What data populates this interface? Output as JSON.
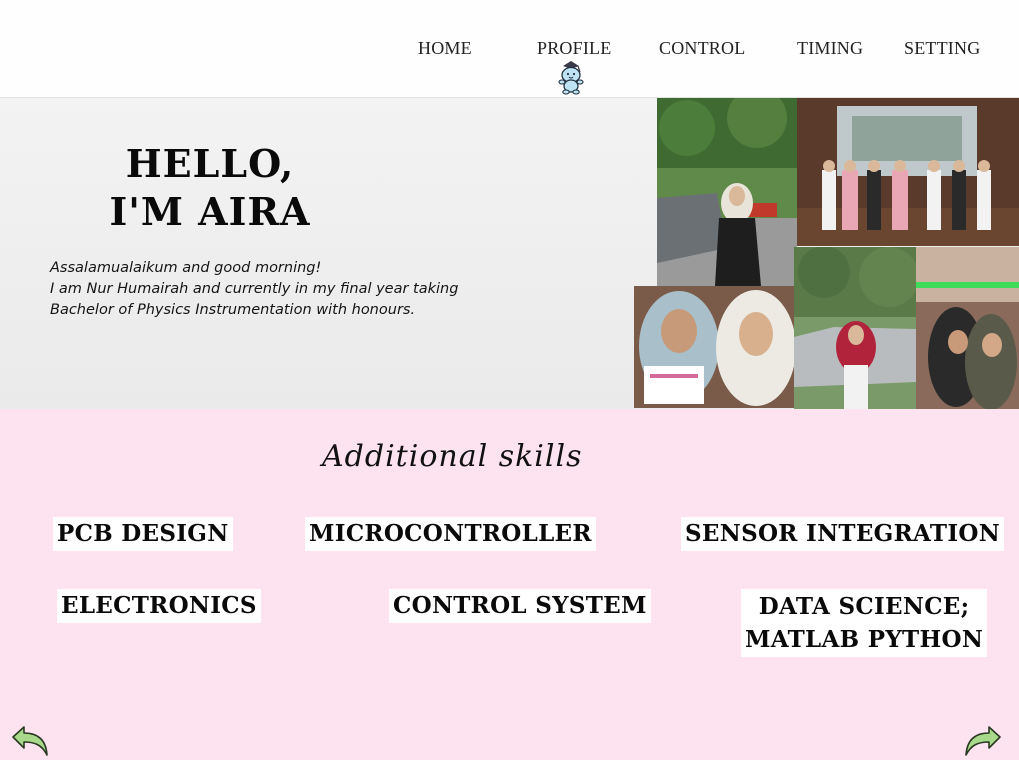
{
  "nav": {
    "items": [
      {
        "id": "home",
        "label": "HOME"
      },
      {
        "id": "profile",
        "label": "PROFILE"
      },
      {
        "id": "control",
        "label": "CONTROL"
      },
      {
        "id": "timing",
        "label": "TIMING"
      },
      {
        "id": "setting",
        "label": "SETTING"
      }
    ],
    "active": "profile",
    "active_indicator_icon": "mascot-icon"
  },
  "hero": {
    "title_line1": "HELLO,",
    "title_line2": "I'M AIRA",
    "intro_lines": [
      "Assalamualaikum and good morning!",
      "I am Nur Humairah and currently in my final year taking",
      "Bachelor of Physics Instrumentation with honours."
    ],
    "background": "#efefef"
  },
  "skills": {
    "heading": "Additional skills",
    "background": "#fde2ef",
    "items": [
      {
        "id": "pcb",
        "label": "PCB DESIGN"
      },
      {
        "id": "micro",
        "label": "MICROCONTROLLER"
      },
      {
        "id": "sensor",
        "label": "SENSOR INTEGRATION"
      },
      {
        "id": "elec",
        "label": "ELECTRONICS"
      },
      {
        "id": "control",
        "label": "CONTROL SYSTEM"
      },
      {
        "id": "data",
        "label_line1": "DATA SCIENCE;",
        "label_line2": "MATLAB PYTHON"
      }
    ]
  },
  "icons": {
    "back": "arrow-back-icon",
    "next": "arrow-forward-icon",
    "arrow_color": "#a8d88a"
  }
}
